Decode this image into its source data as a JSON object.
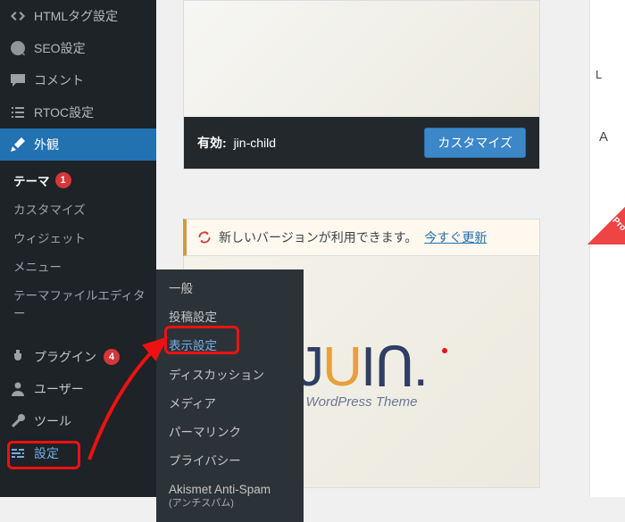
{
  "sidebar": {
    "top_items": [
      {
        "label": "HTMLタグ設定"
      },
      {
        "label": "SEO設定"
      },
      {
        "label": "コメント"
      },
      {
        "label": "RTOC設定"
      }
    ],
    "appearance_label": "外観",
    "appearance_sub": [
      {
        "label": "テーマ",
        "badge": "1"
      },
      {
        "label": "カスタマイズ"
      },
      {
        "label": "ウィジェット"
      },
      {
        "label": "メニュー"
      },
      {
        "label": "テーマファイルエディター"
      }
    ],
    "plugins_label": "プラグイン",
    "plugins_badge": "4",
    "users_label": "ユーザー",
    "tools_label": "ツール",
    "settings_label": "設定"
  },
  "settings_flyout": [
    {
      "label": "一般"
    },
    {
      "label": "投稿設定"
    },
    {
      "label": "表示設定",
      "highlight": true
    },
    {
      "label": "ディスカッション"
    },
    {
      "label": "メディア"
    },
    {
      "label": "パーマリンク"
    },
    {
      "label": "プライバシー"
    },
    {
      "label": "Akismet Anti-Spam",
      "sub": "(アンチスパム)"
    }
  ],
  "theme_card": {
    "active_prefix": "有効:",
    "theme_name": "jin-child",
    "customize_label": "カスタマイズ"
  },
  "update_notice": {
    "text": "新しいバージョンが利用できます。",
    "link": "今すぐ更新"
  },
  "jin": {
    "tagline": "WordPress Theme"
  },
  "right": {
    "label1": "A",
    "label2": "L"
  }
}
